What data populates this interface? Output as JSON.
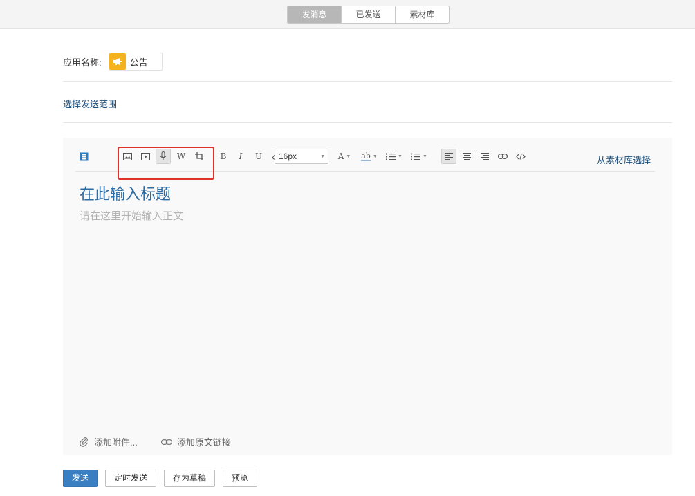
{
  "header": {
    "tabs": [
      {
        "label": "发消息",
        "active": true
      },
      {
        "label": "已发送",
        "active": false
      },
      {
        "label": "素材库",
        "active": false
      }
    ]
  },
  "app": {
    "label": "应用名称:",
    "name": "公告",
    "icon": "megaphone-icon",
    "icon_color": "#f5b21f"
  },
  "scope_link": "选择发送范围",
  "toolbar": {
    "font_size": "16px",
    "from_library": "从素材库选择",
    "icons": [
      "article-icon",
      "image-icon",
      "video-icon",
      "voice-icon",
      "word-icon",
      "crop-icon",
      "bold-icon",
      "italic-icon",
      "underline-icon",
      "eraser-icon",
      "font-color-icon",
      "highlight-icon",
      "ordered-list-icon",
      "unordered-list-icon",
      "align-left-icon",
      "align-center-icon",
      "align-right-icon",
      "link-icon",
      "code-icon"
    ],
    "letters": {
      "word": "W",
      "bold": "B",
      "italic": "I",
      "underline": "U",
      "font_color": "A",
      "highlight": "ab"
    }
  },
  "editor": {
    "title_placeholder": "在此输入标题",
    "body_placeholder": "请在这里开始输入正文"
  },
  "attachments": {
    "add_attachment": "添加附件...",
    "add_source_link": "添加原文链接"
  },
  "actions": {
    "send": "发送",
    "schedule": "定时发送",
    "save_draft": "存为草稿",
    "preview": "预览"
  },
  "colors": {
    "accent": "#3a7fc1",
    "link": "#1e4f7a",
    "highlight_box": "#e0312b",
    "active_tab": "#b7b7b7"
  }
}
